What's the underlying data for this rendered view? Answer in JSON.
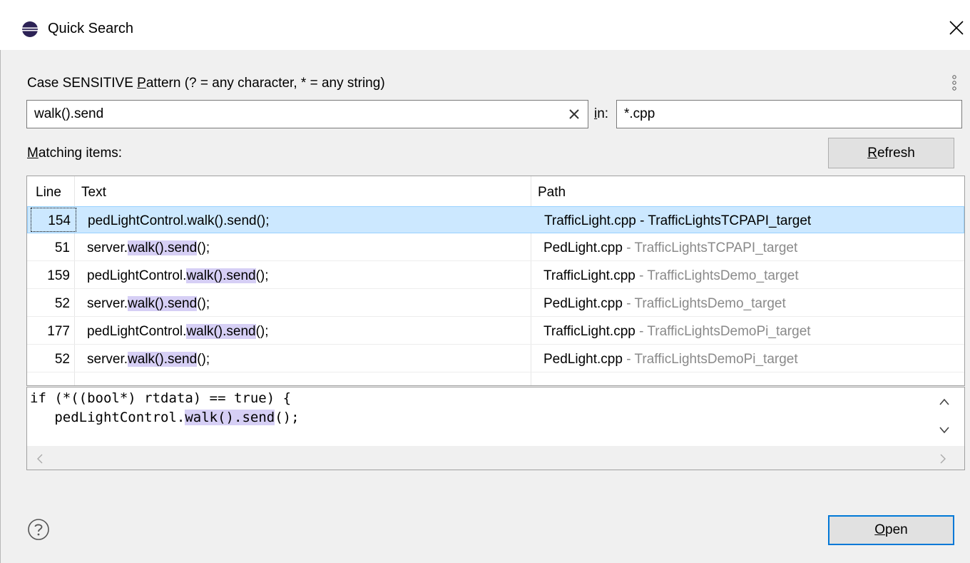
{
  "window": {
    "title": "Quick Search",
    "icon": "eclipse-icon"
  },
  "search": {
    "pattern_label_prefix": "Case SENSITIVE ",
    "pattern_label_mnemonic": "P",
    "pattern_label_suffix": "attern (? = any character, * = any string)",
    "query": "walk().send",
    "in_mnemonic": "i",
    "in_suffix": "n:",
    "filter": "*.cpp"
  },
  "matching": {
    "mnemonic": "M",
    "suffix": "atching items:"
  },
  "refresh": {
    "mnemonic": "R",
    "suffix": "efresh"
  },
  "table": {
    "headers": {
      "line": "Line",
      "text": "Text",
      "path": "Path"
    },
    "rows": [
      {
        "line": "154",
        "pre": "pedLightControl.",
        "m1": "walk()",
        "mid": ".",
        "m2": "send",
        "post": "();",
        "file": "TrafficLight.cpp",
        "project": " - TrafficLightsTCPAPI_target"
      },
      {
        "line": "51",
        "pre": "server.",
        "m1": "walk()",
        "mid": ".",
        "m2": "send",
        "post": "();",
        "file": "PedLight.cpp",
        "project": " - TrafficLightsTCPAPI_target"
      },
      {
        "line": "159",
        "pre": "pedLightControl.",
        "m1": "walk()",
        "mid": ".",
        "m2": "send",
        "post": "();",
        "file": "TrafficLight.cpp",
        "project": " - TrafficLightsDemo_target"
      },
      {
        "line": "52",
        "pre": "server.",
        "m1": "walk()",
        "mid": ".",
        "m2": "send",
        "post": "();",
        "file": "PedLight.cpp",
        "project": " - TrafficLightsDemo_target"
      },
      {
        "line": "177",
        "pre": "pedLightControl.",
        "m1": "walk()",
        "mid": ".",
        "m2": "send",
        "post": "();",
        "file": "TrafficLight.cpp",
        "project": " - TrafficLightsDemoPi_target"
      },
      {
        "line": "52",
        "pre": "server.",
        "m1": "walk()",
        "mid": ".",
        "m2": "send",
        "post": "();",
        "file": "PedLight.cpp",
        "project": " - TrafficLightsDemoPi_target"
      }
    ],
    "selected_index": 0
  },
  "preview": {
    "line1": "if (*((bool*) rtdata) == true) {",
    "line2_pre": "   pedLightControl.",
    "line2_m1": "walk()",
    "line2_mid": ".",
    "line2_m2": "send",
    "line2_post": "();"
  },
  "open": {
    "mnemonic": "O",
    "suffix": "pen"
  },
  "colors": {
    "selection": "#cce8ff",
    "match_highlight": "#d6cff5",
    "default_button_border": "#0078d7"
  }
}
